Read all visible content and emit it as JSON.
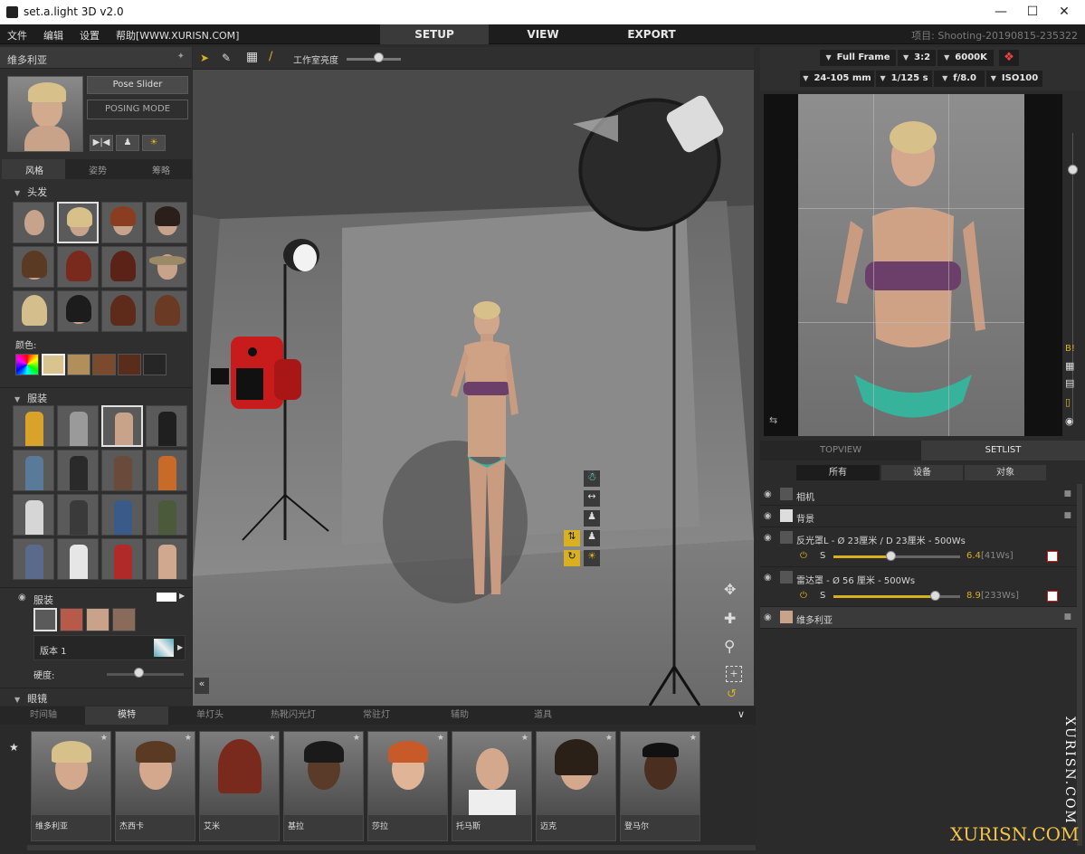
{
  "window": {
    "title": "set.a.light 3D v2.0"
  },
  "menu": {
    "items": [
      "文件",
      "编辑",
      "设置",
      "帮助[WWW.XURISN.COM]"
    ],
    "tabs": [
      "SETUP",
      "VIEW",
      "EXPORT"
    ],
    "active_tab": "SETUP",
    "project": "项目: Shooting-20190815-235322"
  },
  "left_panel": {
    "model_name": "维多利亚",
    "pose_slider_label": "Pose Slider",
    "posing_mode_label": "POSING MODE",
    "tabs": [
      "风格",
      "姿势",
      "筹略"
    ],
    "sections": {
      "hair": "头发",
      "color": "颜色:",
      "clothing": "服装",
      "clothing_layer": "服装",
      "version_label": "版本 1",
      "hardness": "硬度:",
      "glasses": "眼镜"
    }
  },
  "viewport_toolbar": {
    "brightness_label": "工作室亮度"
  },
  "camera": {
    "sensor": "Full Frame",
    "ratio": "3:2",
    "temperature": "6000K",
    "lens": "24-105 mm",
    "shutter": "1/125 s",
    "aperture": "f/8.0",
    "iso": "ISO100"
  },
  "right_panel": {
    "tabs": [
      "TOPVIEW",
      "SETLIST"
    ],
    "active_tab": "SETLIST",
    "filters": [
      "所有",
      "设备",
      "对象"
    ],
    "items": [
      {
        "label": "相机"
      },
      {
        "label": "背景"
      },
      {
        "label": "反光罩L - Ø 23厘米 / D 23厘米 - 500Ws",
        "s": "S",
        "value": "6.4",
        "ws": "[41Ws]",
        "level": 0.45
      },
      {
        "label": "雷达罩 - Ø 56 厘米 - 500Ws",
        "s": "S",
        "value": "8.9",
        "ws": "[233Ws]",
        "level": 0.8
      },
      {
        "label": "维多利亚"
      }
    ]
  },
  "bottom": {
    "tabs": [
      "时间轴",
      "模特",
      "单灯头",
      "热靴闪光灯",
      "常驻灯",
      "辅助",
      "道具"
    ],
    "active_tab": "模特",
    "models": [
      "维多利亚",
      "杰西卡",
      "艾米",
      "基拉",
      "莎拉",
      "托马斯",
      "迈克",
      "登马尔"
    ]
  },
  "watermark": {
    "side": "XURISN.COM",
    "corner": "XURISN.COM"
  },
  "colors": {
    "accent": "#d9b01f",
    "panel": "#2f2f2f",
    "active_tab": "#3a3a3a"
  }
}
